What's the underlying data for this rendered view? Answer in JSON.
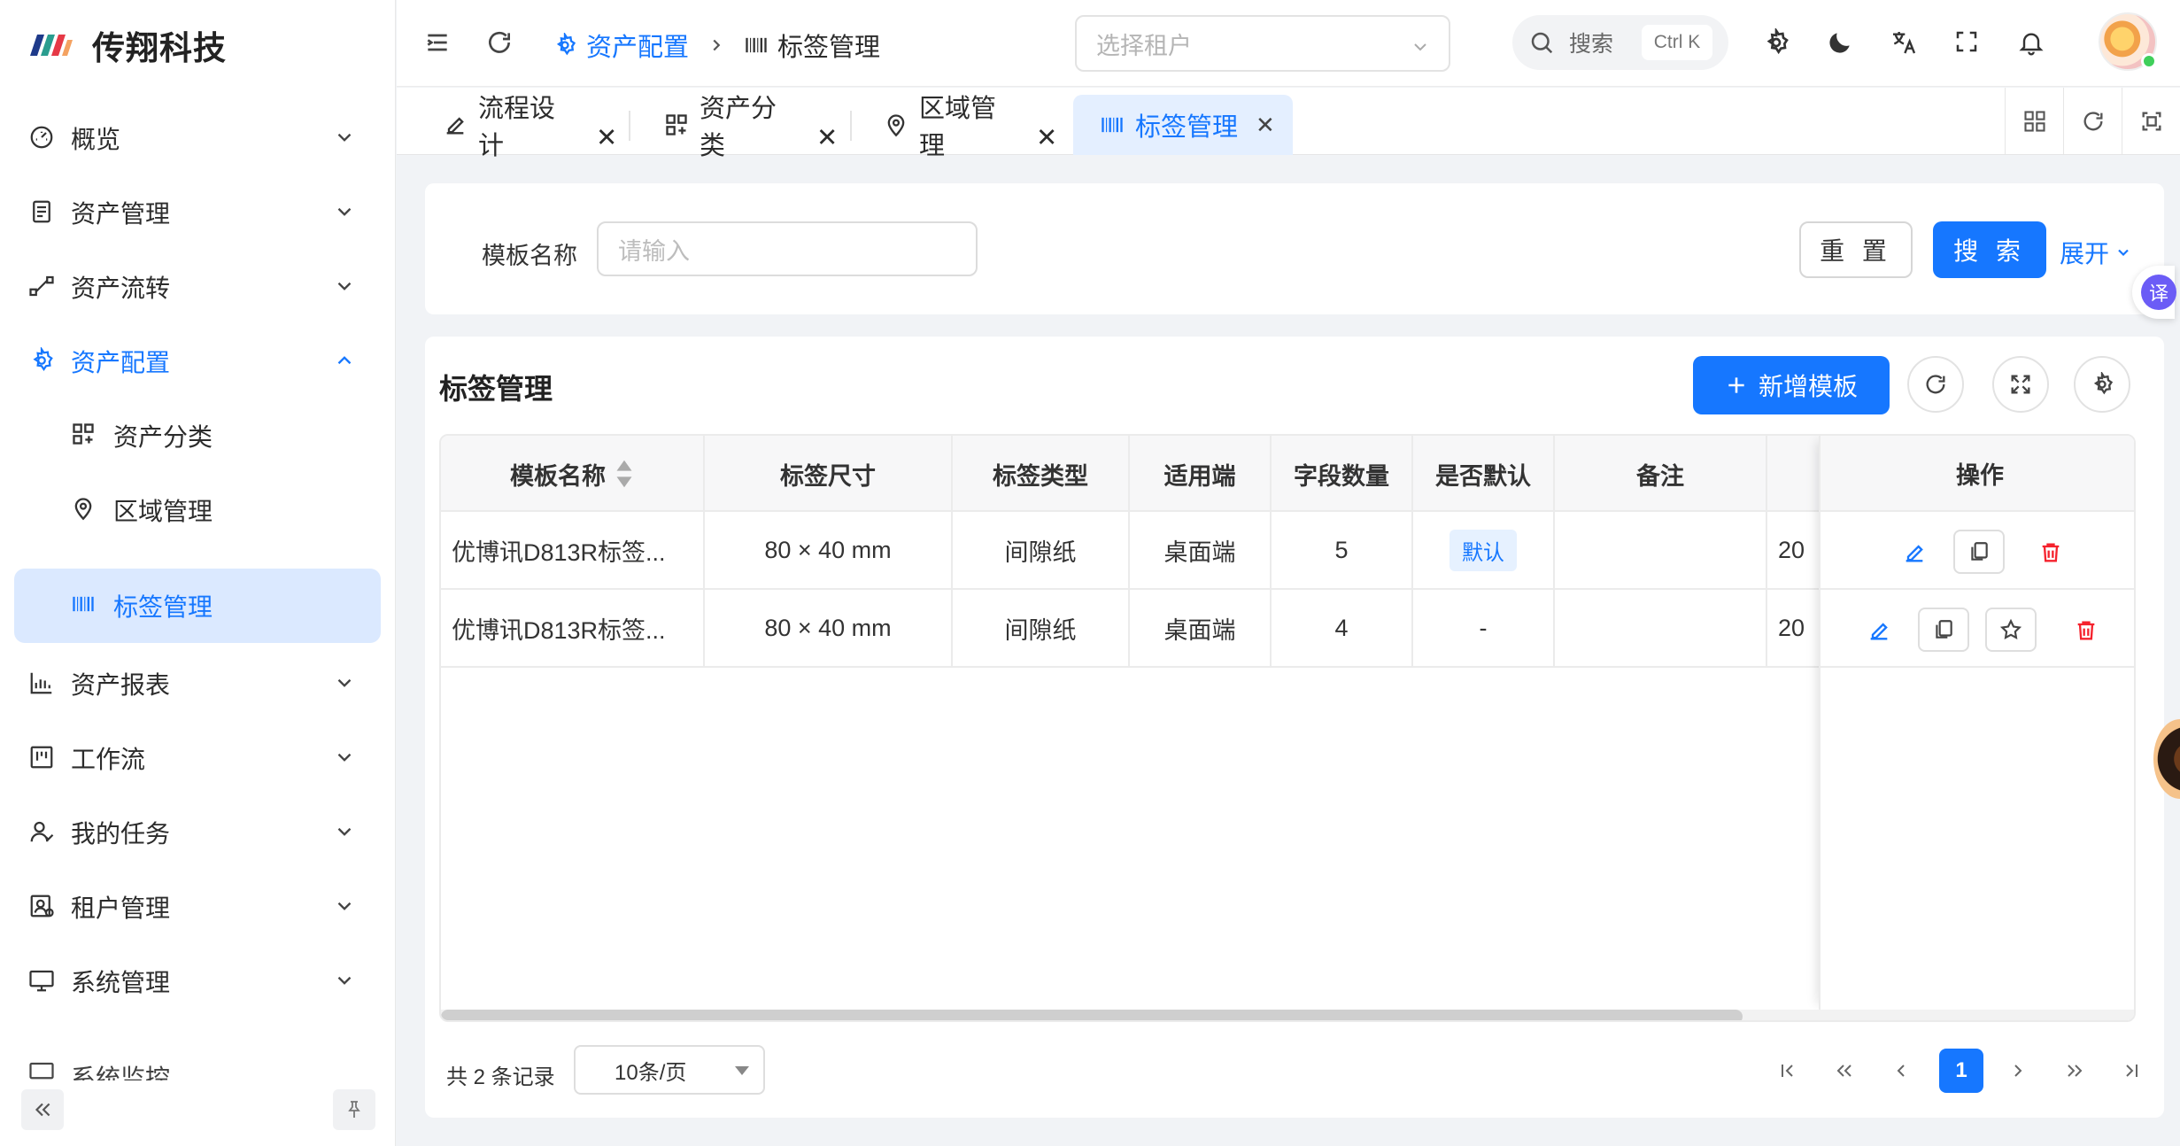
{
  "brand": {
    "name": "传翔科技"
  },
  "sidebar": {
    "items": [
      {
        "label": "概览",
        "icon": "dashboard-icon",
        "expanded": false
      },
      {
        "label": "资产管理",
        "icon": "document-icon",
        "expanded": false
      },
      {
        "label": "资产流转",
        "icon": "flow-icon",
        "expanded": false
      },
      {
        "label": "资产配置",
        "icon": "gear-icon",
        "expanded": true
      },
      {
        "label": "资产分类",
        "icon": "category-icon"
      },
      {
        "label": "区域管理",
        "icon": "location-icon"
      },
      {
        "label": "标签管理",
        "icon": "barcode-icon",
        "selected": true
      },
      {
        "label": "资产报表",
        "icon": "bar-chart-icon",
        "expanded": false
      },
      {
        "label": "工作流",
        "icon": "kanban-icon",
        "expanded": false
      },
      {
        "label": "我的任务",
        "icon": "user-task-icon",
        "expanded": false
      },
      {
        "label": "租户管理",
        "icon": "tenant-icon",
        "expanded": false
      },
      {
        "label": "系统管理",
        "icon": "monitor-icon",
        "expanded": false
      },
      {
        "label": "系统监控",
        "icon": "monitor-icon",
        "expanded": false
      }
    ]
  },
  "header": {
    "breadcrumb": [
      "资产配置",
      "标签管理"
    ],
    "tenant_placeholder": "选择租户",
    "search_label": "搜索",
    "search_shortcut": "Ctrl K"
  },
  "tabs": [
    {
      "label": "流程设计",
      "icon": "edit-icon",
      "active": false
    },
    {
      "label": "资产分类",
      "icon": "category-icon",
      "active": false
    },
    {
      "label": "区域管理",
      "icon": "location-icon",
      "active": false
    },
    {
      "label": "标签管理",
      "icon": "barcode-icon",
      "active": true
    }
  ],
  "filter": {
    "label": "模板名称",
    "placeholder": "请输入",
    "reset": "重 置",
    "search": "搜 索",
    "expand": "展开"
  },
  "panel": {
    "title": "标签管理",
    "add_button": "新增模板",
    "columns": [
      "模板名称",
      "标签尺寸",
      "标签类型",
      "适用端",
      "字段数量",
      "是否默认",
      "备注",
      "操作"
    ],
    "rows": [
      {
        "name": "优博讯D813R标签...",
        "size": "80 × 40 mm",
        "type": "间隙纸",
        "platform": "桌面端",
        "fields": "5",
        "default": "默认",
        "remark": "",
        "created": "20"
      },
      {
        "name": "优博讯D813R标签...",
        "size": "80 × 40 mm",
        "type": "间隙纸",
        "platform": "桌面端",
        "fields": "4",
        "default": "-",
        "remark": "",
        "created": "20"
      }
    ],
    "total": "共 2 条记录",
    "page_size": "10条/页",
    "current_page": "1"
  },
  "float": {
    "translate": "译"
  },
  "colors": {
    "primary": "#1677ff",
    "danger": "#f5222d",
    "selected_bg": "#dbe9ff"
  }
}
